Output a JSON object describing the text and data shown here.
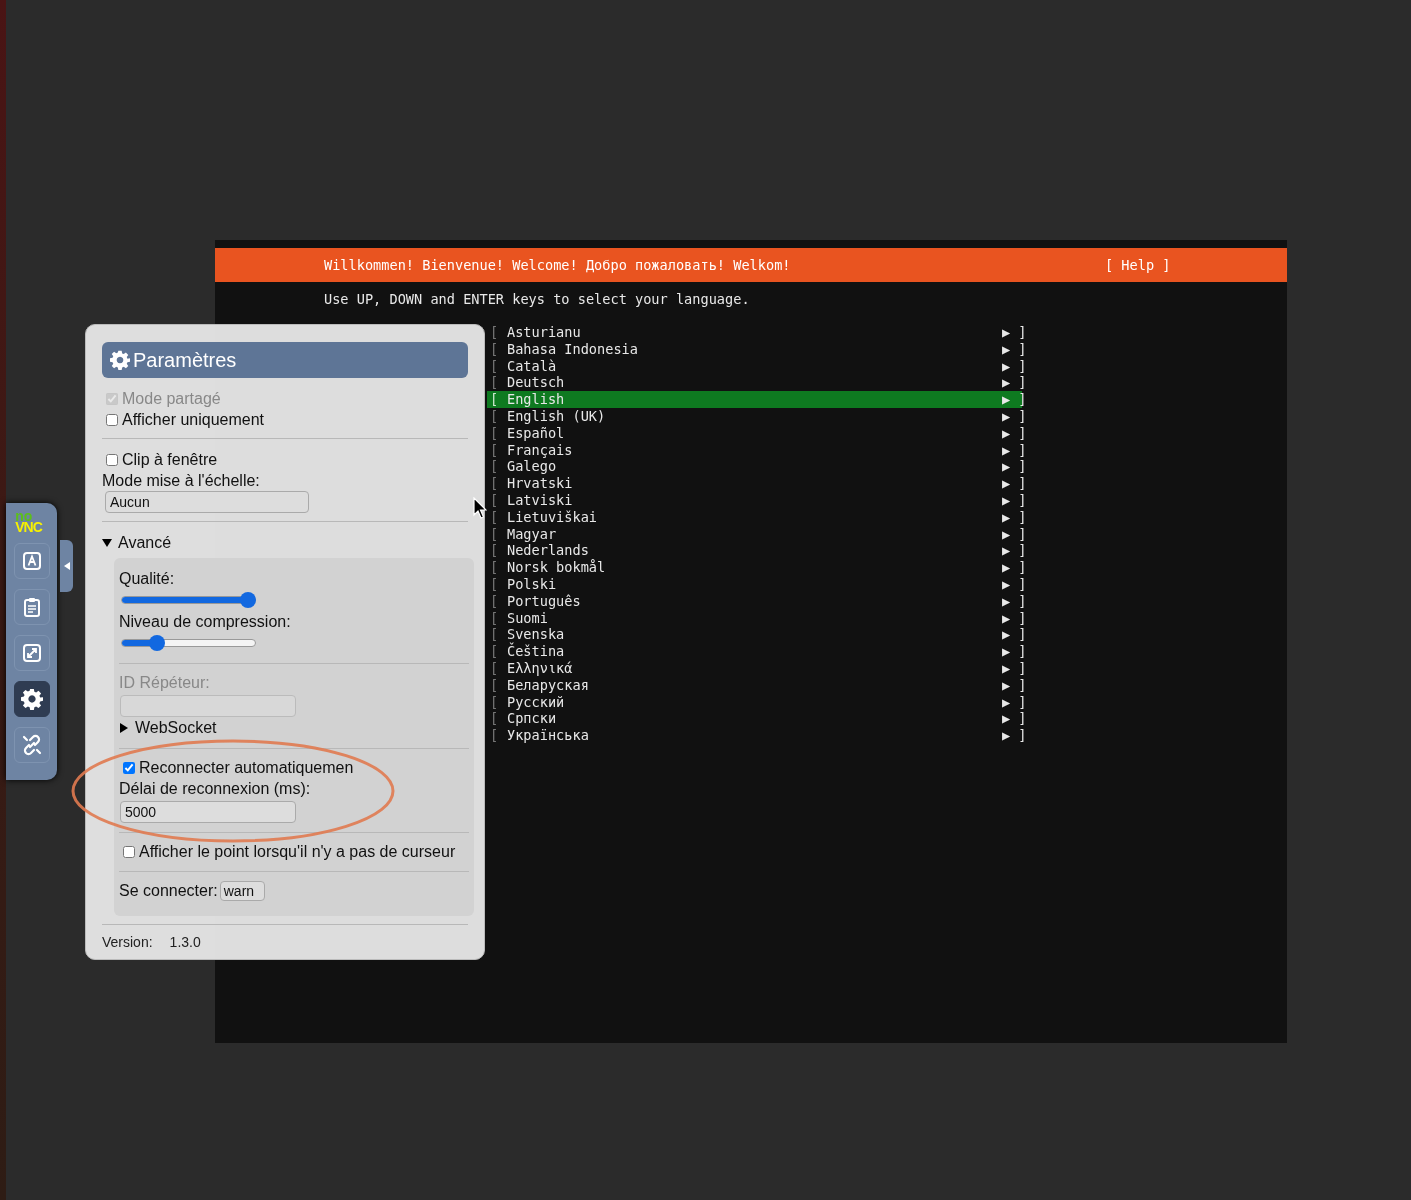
{
  "terminal": {
    "banner": {
      "title": "Willkommen! Bienvenue! Welcome! Добро пожаловать! Welkom!",
      "help": "[ Help ]"
    },
    "instruction": "Use UP, DOWN and ENTER keys to select your language.",
    "languages": [
      {
        "prefix": "[",
        "name": "Asturianu",
        "suffix": "▶ ]",
        "selected": false
      },
      {
        "prefix": "[",
        "name": "Bahasa Indonesia",
        "suffix": "▶ ]",
        "selected": false
      },
      {
        "prefix": "[",
        "name": "Català",
        "suffix": "▶ ]",
        "selected": false
      },
      {
        "prefix": "[",
        "name": "Deutsch",
        "suffix": "▶ ]",
        "selected": false
      },
      {
        "prefix": "[",
        "name": "English",
        "suffix": "▶ ]",
        "selected": true
      },
      {
        "prefix": "[",
        "name": "English (UK)",
        "suffix": "▶ ]",
        "selected": false
      },
      {
        "prefix": "[",
        "name": "Español",
        "suffix": "▶ ]",
        "selected": false
      },
      {
        "prefix": "[",
        "name": "Français",
        "suffix": "▶ ]",
        "selected": false
      },
      {
        "prefix": "[",
        "name": "Galego",
        "suffix": "▶ ]",
        "selected": false
      },
      {
        "prefix": "[",
        "name": "Hrvatski",
        "suffix": "▶ ]",
        "selected": false
      },
      {
        "prefix": "[",
        "name": "Latviski",
        "suffix": "▶ ]",
        "selected": false
      },
      {
        "prefix": "[",
        "name": "Lietuviškai",
        "suffix": "▶ ]",
        "selected": false
      },
      {
        "prefix": "[",
        "name": "Magyar",
        "suffix": "▶ ]",
        "selected": false
      },
      {
        "prefix": "[",
        "name": "Nederlands",
        "suffix": "▶ ]",
        "selected": false
      },
      {
        "prefix": "[",
        "name": "Norsk bokmål",
        "suffix": "▶ ]",
        "selected": false
      },
      {
        "prefix": "[",
        "name": "Polski",
        "suffix": "▶ ]",
        "selected": false
      },
      {
        "prefix": "[",
        "name": "Português",
        "suffix": "▶ ]",
        "selected": false
      },
      {
        "prefix": "[",
        "name": "Suomi",
        "suffix": "▶ ]",
        "selected": false
      },
      {
        "prefix": "[",
        "name": "Svenska",
        "suffix": "▶ ]",
        "selected": false
      },
      {
        "prefix": "[",
        "name": "Čeština",
        "suffix": "▶ ]",
        "selected": false
      },
      {
        "prefix": "[",
        "name": "Ελληνικά",
        "suffix": "▶ ]",
        "selected": false
      },
      {
        "prefix": "[",
        "name": "Беларуская",
        "suffix": "▶ ]",
        "selected": false
      },
      {
        "prefix": "[",
        "name": "Русский",
        "suffix": "▶ ]",
        "selected": false
      },
      {
        "prefix": "[",
        "name": "Српски",
        "suffix": "▶ ]",
        "selected": false
      },
      {
        "prefix": "[",
        "name": "Українська",
        "suffix": "▶ ]",
        "selected": false
      }
    ]
  },
  "sidebar": {
    "logo": {
      "top": "no",
      "bottom": "VNC"
    },
    "buttons": [
      {
        "kind": "keyboard",
        "selected": false
      },
      {
        "kind": "clipboard",
        "selected": false
      },
      {
        "kind": "fullscreen",
        "selected": false
      },
      {
        "kind": "settings",
        "selected": true
      },
      {
        "kind": "disconnect",
        "selected": false
      }
    ]
  },
  "settings": {
    "title": "Paramètres",
    "groups": [
      [
        {
          "kind": "checkbox",
          "label": "Mode partagé",
          "checked": true,
          "disabled": true
        },
        {
          "kind": "checkbox",
          "label": "Afficher uniquement",
          "checked": false,
          "disabled": false
        }
      ],
      [
        {
          "kind": "checkbox",
          "label": "Clip à fenêtre",
          "checked": false,
          "disabled": false
        },
        {
          "kind": "select",
          "label": "Mode mise à l'échelle:",
          "value": "Aucun"
        }
      ],
      [
        {
          "kind": "expander",
          "label": "Avancé",
          "expanded": true,
          "groups": [
            [
              {
                "kind": "slider",
                "label": "Qualité:",
                "level": 0.95
              },
              {
                "kind": "slider",
                "label": "Niveau de compression:",
                "level": 0.26
              }
            ],
            [
              {
                "kind": "field",
                "label": "ID Répéteur:",
                "disabled": true
              },
              {
                "kind": "expander",
                "label": "WebSocket",
                "expanded": false
              }
            ],
            [
              {
                "kind": "checkbox",
                "label": "Reconnecter automatiquemen",
                "checked": true,
                "disabled": false
              },
              {
                "kind": "field",
                "label": "Délai de reconnexion (ms):",
                "value": "5000",
                "disabled": false
              }
            ],
            [
              {
                "kind": "checkbox",
                "label": "Afficher le point lorsqu'il n'y a pas de curseur",
                "checked": false,
                "disabled": false
              }
            ],
            [
              {
                "kind": "inline-select",
                "label": "Se connecter:",
                "value": "warn"
              }
            ]
          ]
        }
      ]
    ],
    "version": {
      "label": "Version:",
      "value": "1.3.0"
    }
  }
}
